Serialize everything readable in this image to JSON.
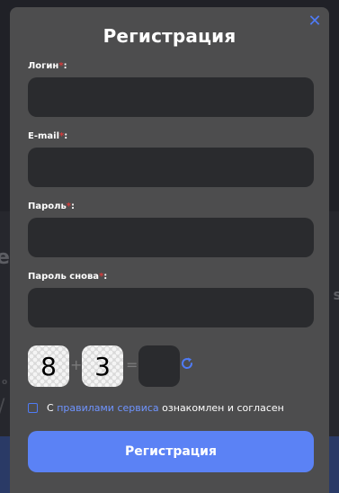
{
  "modal": {
    "title": "Регистрация",
    "close_symbol": "✕",
    "close_icon": "close-icon"
  },
  "fields": {
    "login": {
      "label": "Логин",
      "required_mark": "*",
      "suffix": ":",
      "value": "",
      "placeholder": ""
    },
    "email": {
      "label": "E-mail",
      "required_mark": "*",
      "suffix": ":",
      "value": "",
      "placeholder": ""
    },
    "password": {
      "label": "Пароль",
      "required_mark": "*",
      "suffix": ":",
      "value": "",
      "placeholder": ""
    },
    "password_repeat": {
      "label": "Пароль снова",
      "required_mark": "*",
      "suffix": ":",
      "value": "",
      "placeholder": ""
    }
  },
  "captcha": {
    "operand_a": "8",
    "operator": "+",
    "operand_b": "3",
    "equals": "=",
    "answer": "",
    "refresh_icon": "refresh-icon"
  },
  "agreement": {
    "prefix": "С",
    "link_text": "правилами сервиса",
    "suffix": "ознакомлен и согласен",
    "checked": false
  },
  "submit": {
    "label": "Регистрация"
  },
  "colors": {
    "accent": "#5b82f5",
    "link": "#6f94ff",
    "modal_bg": "#4d4d4e",
    "input_bg": "#2a2b2e",
    "required": "#d93a3a"
  }
}
